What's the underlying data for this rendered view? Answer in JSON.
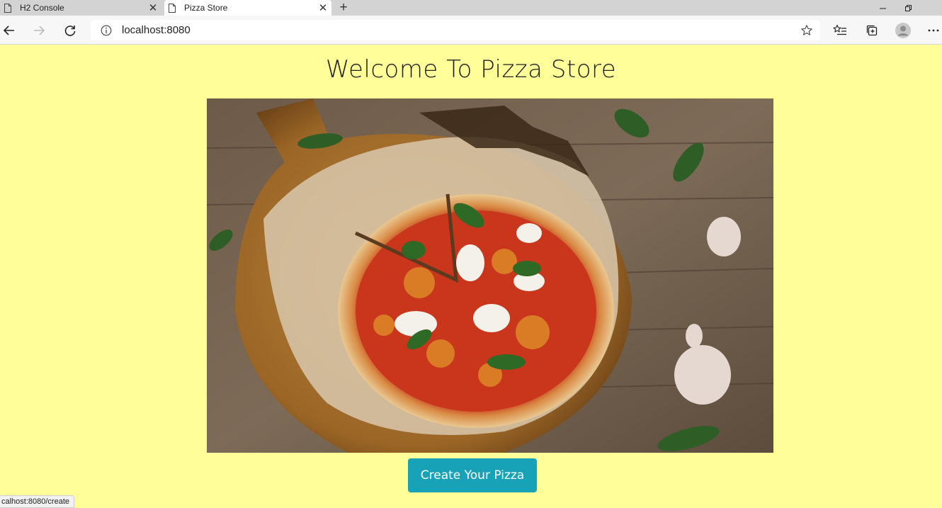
{
  "browser": {
    "tabs": [
      {
        "label": "H2 Console",
        "active": false
      },
      {
        "label": "Pizza Store",
        "active": true
      }
    ],
    "address": "localhost:8080",
    "status_url": "calhost:8080/create"
  },
  "page": {
    "title": "Welcome To Pizza Store",
    "hero_alt": "Pizza Store",
    "cta_label": "Create Your Pizza"
  },
  "colors": {
    "page_background": "#fffe99",
    "cta_background": "#17a2b8",
    "cta_text": "#ffffff"
  }
}
